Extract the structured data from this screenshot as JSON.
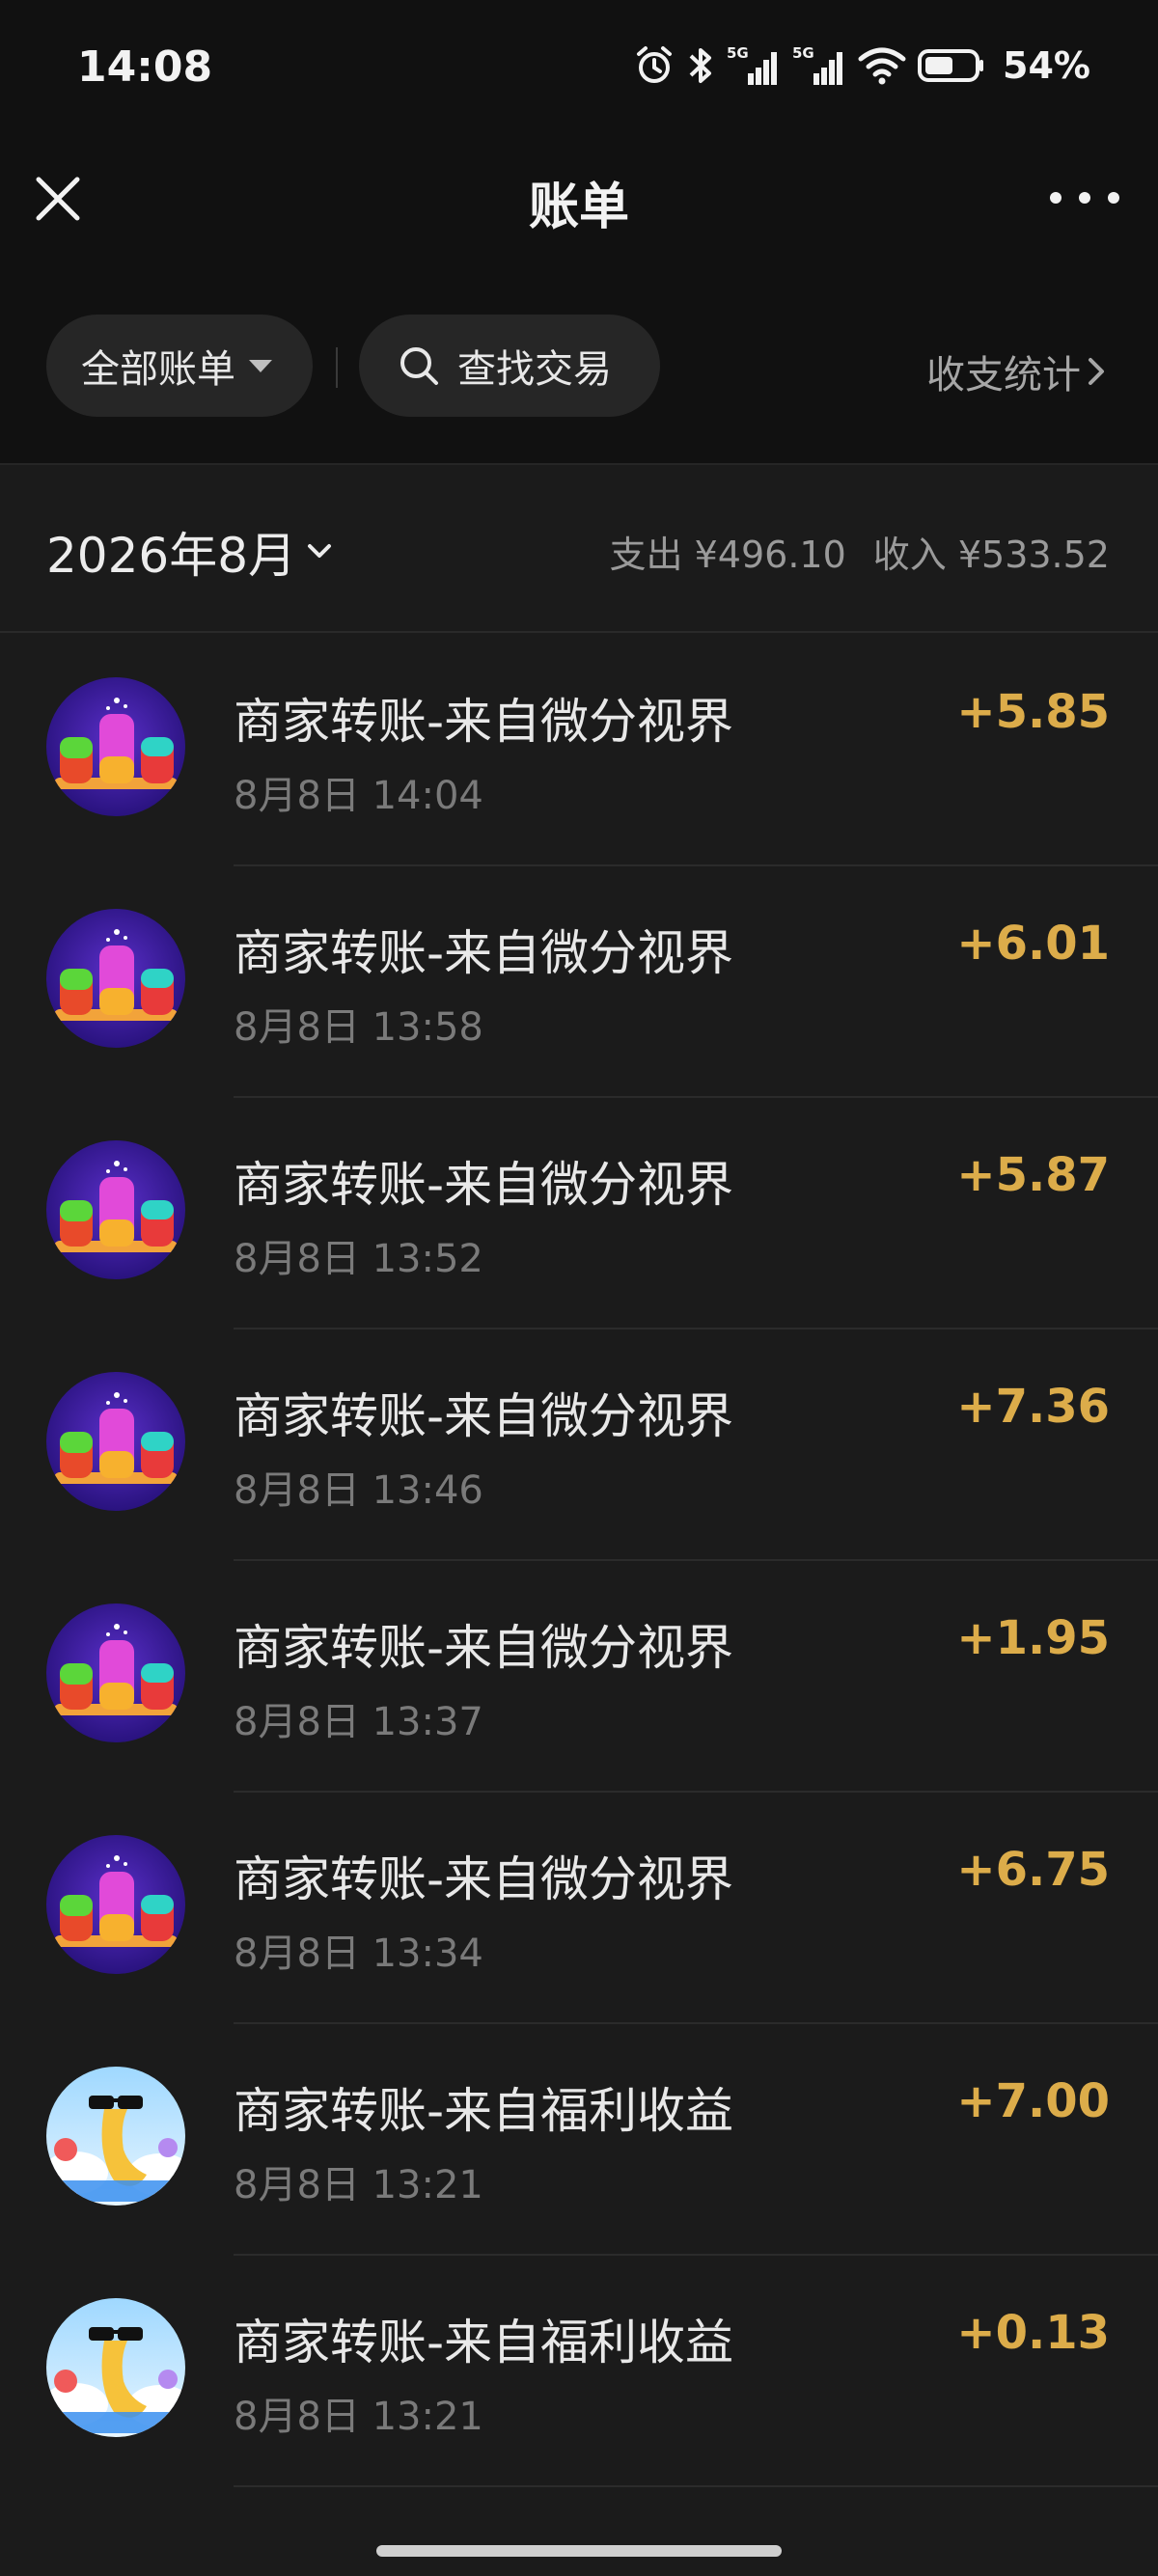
{
  "status_bar": {
    "time": "14:08",
    "battery": "54%",
    "icons": [
      "alarm-icon",
      "bluetooth-icon",
      "signal-5g-icon",
      "signal-5g-icon",
      "wifi-icon",
      "battery-icon"
    ]
  },
  "nav": {
    "title": "账单",
    "close_icon": "close-icon",
    "more_icon": "more-icon"
  },
  "filters": {
    "all_bills_label": "全部账单",
    "search_label": "查找交易",
    "stats_label": "收支统计"
  },
  "month": {
    "label": "2026年8月",
    "expense": "支出 ¥496.10",
    "income": "收入 ¥533.52"
  },
  "transactions": [
    {
      "title": "商家转账-来自微分视界",
      "time": "8月8日 14:04",
      "amount": "+5.85",
      "avatar": "bottles-avatar"
    },
    {
      "title": "商家转账-来自微分视界",
      "time": "8月8日 13:58",
      "amount": "+6.01",
      "avatar": "bottles-avatar"
    },
    {
      "title": "商家转账-来自微分视界",
      "time": "8月8日 13:52",
      "amount": "+5.87",
      "avatar": "bottles-avatar"
    },
    {
      "title": "商家转账-来自微分视界",
      "time": "8月8日 13:46",
      "amount": "+7.36",
      "avatar": "bottles-avatar"
    },
    {
      "title": "商家转账-来自微分视界",
      "time": "8月8日 13:37",
      "amount": "+1.95",
      "avatar": "bottles-avatar"
    },
    {
      "title": "商家转账-来自微分视界",
      "time": "8月8日 13:34",
      "amount": "+6.75",
      "avatar": "bottles-avatar"
    },
    {
      "title": "商家转账-来自福利收益",
      "time": "8月8日 13:21",
      "amount": "+7.00",
      "avatar": "cartoon-avatar"
    },
    {
      "title": "商家转账-来自福利收益",
      "time": "8月8日 13:21",
      "amount": "+0.13",
      "avatar": "cartoon-avatar"
    }
  ],
  "colors": {
    "background": "#1b1b1b",
    "header_background": "#111111",
    "amount": "#dcac4a",
    "secondary_text": "#7a7a7a"
  }
}
